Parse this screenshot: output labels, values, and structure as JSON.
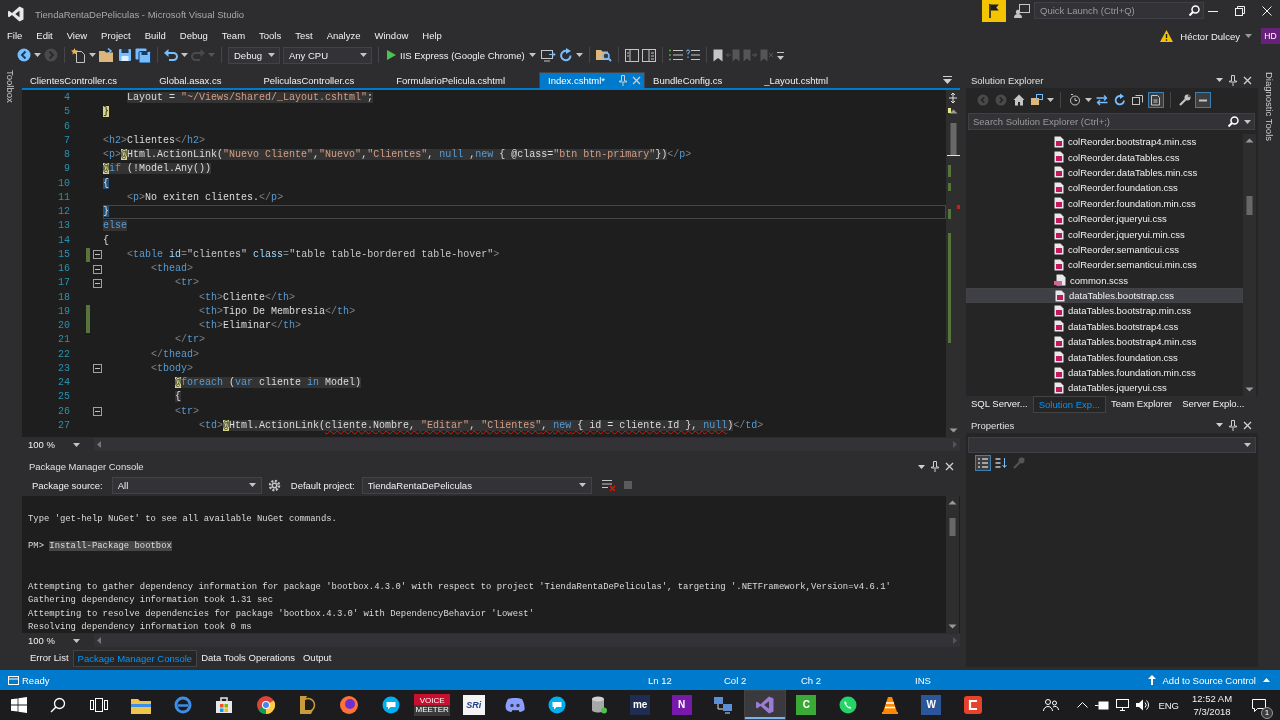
{
  "title_bar": {
    "title": "TiendaRentaDePeliculas - Microsoft Visual Studio",
    "quick_launch": {
      "placeholder": "Quick Launch (Ctrl+Q)"
    }
  },
  "menu": [
    "File",
    "Edit",
    "View",
    "Project",
    "Build",
    "Debug",
    "Team",
    "Tools",
    "Test",
    "Analyze",
    "Window",
    "Help"
  ],
  "account": {
    "name": "Héctor Dulcey",
    "initials": "HD"
  },
  "toolbar": [
    {
      "kind": "back",
      "disabled": false
    },
    {
      "kind": "forward",
      "disabled": true
    },
    {
      "kind": "new",
      "disabled": false
    },
    {
      "kind": "open",
      "disabled": false
    },
    {
      "kind": "save",
      "disabled": false
    },
    {
      "kind": "save-all",
      "disabled": false
    },
    {
      "kind": "undo",
      "disabled": false
    },
    {
      "kind": "redo",
      "disabled": true
    },
    {
      "kind": "dropdown",
      "value": "Debug",
      "disabled": false
    },
    {
      "kind": "dropdown",
      "value": "Any CPU",
      "disabled": false
    },
    {
      "kind": "run",
      "value": "IIS Express (Google Chrome)",
      "disabled": false
    },
    {
      "kind": "browser",
      "disabled": false
    },
    {
      "kind": "refresh",
      "disabled": false
    },
    {
      "kind": "find",
      "disabled": false
    },
    {
      "kind": "layout",
      "disabled": false
    },
    {
      "kind": "layout-split",
      "disabled": false
    },
    {
      "kind": "comment",
      "disabled": false
    },
    {
      "kind": "uncomment",
      "disabled": false
    },
    {
      "kind": "bookmark",
      "disabled": false
    },
    {
      "kind": "bookmark-prev",
      "disabled": true
    },
    {
      "kind": "bookmark-next",
      "disabled": true
    },
    {
      "kind": "bookmark-clear",
      "disabled": true
    },
    {
      "kind": "overflow",
      "disabled": false
    }
  ],
  "document_tabs": [
    {
      "label": "ClientesController.cs",
      "selected": false
    },
    {
      "label": "Global.asax.cs",
      "selected": false
    },
    {
      "label": "PeliculasController.cs",
      "selected": false
    },
    {
      "label": "FormularioPelicula.cshtml",
      "selected": false
    },
    {
      "label": "Index.cshtml*",
      "selected": true
    },
    {
      "label": "BundleConfig.cs",
      "selected": false
    },
    {
      "label": "_Layout.cshtml",
      "selected": false
    }
  ],
  "editor": {
    "lines": [
      {
        "number": "4",
        "changed": false,
        "fold": false,
        "current": false,
        "tokens": [
          {
            "kind": "cs",
            "text": "    Layout = "
          },
          {
            "kind": "cs-str",
            "text": "\"~/Views/Shared/_Layout.cshtml\""
          },
          {
            "kind": "cs",
            "text": ";"
          }
        ]
      },
      {
        "number": "5",
        "changed": false,
        "fold": false,
        "current": false,
        "tokens": [
          {
            "kind": "at",
            "text": "}"
          }
        ]
      },
      {
        "number": "6",
        "changed": false,
        "fold": false,
        "current": false
      },
      {
        "number": "7",
        "changed": false,
        "fold": false,
        "current": false,
        "tokens": [
          {
            "kind": "delim",
            "text": "<"
          },
          {
            "kind": "tag",
            "text": "h2"
          },
          {
            "kind": "delim",
            "text": ">"
          },
          {
            "kind": "text",
            "text": "Clientes"
          },
          {
            "kind": "delim",
            "text": "</"
          },
          {
            "kind": "tag",
            "text": "h2"
          },
          {
            "kind": "delim",
            "text": ">"
          }
        ]
      },
      {
        "number": "8",
        "changed": false,
        "fold": false,
        "current": false,
        "tokens": [
          {
            "kind": "delim",
            "text": "<"
          },
          {
            "kind": "tag",
            "text": "p"
          },
          {
            "kind": "delim",
            "text": ">"
          },
          {
            "kind": "at",
            "text": "@"
          },
          {
            "kind": "cs",
            "text": "Html.ActionLink("
          },
          {
            "kind": "cs-str",
            "text": "\"Nuevo Cliente\""
          },
          {
            "kind": "cs",
            "text": ","
          },
          {
            "kind": "cs-str",
            "text": "\"Nuevo\""
          },
          {
            "kind": "cs",
            "text": ","
          },
          {
            "kind": "cs-str",
            "text": "\"Clientes\""
          },
          {
            "kind": "cs",
            "text": ", "
          },
          {
            "kind": "cs-kw",
            "text": "null"
          },
          {
            "kind": "cs",
            "text": " ,"
          },
          {
            "kind": "cs-kw",
            "text": "new"
          },
          {
            "kind": "cs",
            "text": " { @class="
          },
          {
            "kind": "cs-str",
            "text": "\"btn btn-primary\""
          },
          {
            "kind": "cs",
            "text": "})"
          },
          {
            "kind": "delim",
            "text": "</"
          },
          {
            "kind": "tag",
            "text": "p"
          },
          {
            "kind": "delim",
            "text": ">"
          }
        ]
      },
      {
        "number": "9",
        "changed": false,
        "fold": false,
        "current": false,
        "tokens": [
          {
            "kind": "at",
            "text": "@"
          },
          {
            "kind": "cs-kw",
            "text": "if"
          },
          {
            "kind": "cs",
            "text": " (!Model.Any())"
          }
        ]
      },
      {
        "number": "10",
        "changed": false,
        "fold": false,
        "current": false,
        "tokens": [
          {
            "kind": "brace",
            "text": "{"
          }
        ]
      },
      {
        "number": "11",
        "changed": false,
        "fold": false,
        "current": false,
        "tokens": [
          {
            "kind": "delim",
            "text": "    <"
          },
          {
            "kind": "tag",
            "text": "p"
          },
          {
            "kind": "delim",
            "text": ">"
          },
          {
            "kind": "text",
            "text": "No exiten clientes."
          },
          {
            "kind": "delim",
            "text": "</"
          },
          {
            "kind": "tag",
            "text": "p"
          },
          {
            "kind": "delim",
            "text": ">"
          }
        ]
      },
      {
        "number": "12",
        "changed": false,
        "fold": false,
        "current": true,
        "tokens": [
          {
            "kind": "brace",
            "text": "}"
          }
        ]
      },
      {
        "number": "13",
        "changed": false,
        "fold": false,
        "current": false,
        "tokens": [
          {
            "kind": "cs-kw",
            "text": "else"
          }
        ]
      },
      {
        "number": "14",
        "changed": false,
        "fold": false,
        "current": false,
        "tokens": [
          {
            "kind": "text",
            "text": "{"
          }
        ]
      },
      {
        "number": "15",
        "changed": true,
        "fold": true,
        "current": false,
        "tokens": [
          {
            "kind": "delim",
            "text": "    <"
          },
          {
            "kind": "tag",
            "text": "table"
          },
          {
            "kind": "attr",
            "text": " id"
          },
          {
            "kind": "delim",
            "text": "="
          },
          {
            "kind": "val",
            "text": "\"clientes\""
          },
          {
            "kind": "attr",
            "text": " class"
          },
          {
            "kind": "delim",
            "text": "="
          },
          {
            "kind": "val",
            "text": "\"table table-bordered table-hover\""
          },
          {
            "kind": "delim",
            "text": ">"
          }
        ]
      },
      {
        "number": "16",
        "changed": false,
        "fold": true,
        "current": false,
        "tokens": [
          {
            "kind": "delim",
            "text": "        <"
          },
          {
            "kind": "tag",
            "text": "thead"
          },
          {
            "kind": "delim",
            "text": ">"
          }
        ]
      },
      {
        "number": "17",
        "changed": false,
        "fold": true,
        "current": false,
        "tokens": [
          {
            "kind": "delim",
            "text": "            <"
          },
          {
            "kind": "tag",
            "text": "tr"
          },
          {
            "kind": "delim",
            "text": ">"
          }
        ]
      },
      {
        "number": "18",
        "changed": false,
        "fold": false,
        "current": false,
        "tokens": [
          {
            "kind": "delim",
            "text": "                <"
          },
          {
            "kind": "tag",
            "text": "th"
          },
          {
            "kind": "delim",
            "text": ">"
          },
          {
            "kind": "text",
            "text": "Cliente"
          },
          {
            "kind": "delim",
            "text": "</"
          },
          {
            "kind": "tag",
            "text": "th"
          },
          {
            "kind": "delim",
            "text": ">"
          }
        ]
      },
      {
        "number": "19",
        "changed": true,
        "fold": false,
        "current": false,
        "tokens": [
          {
            "kind": "delim",
            "text": "                <"
          },
          {
            "kind": "tag",
            "text": "th"
          },
          {
            "kind": "delim",
            "text": ">"
          },
          {
            "kind": "text",
            "text": "Tipo De Membresia"
          },
          {
            "kind": "delim",
            "text": "</"
          },
          {
            "kind": "tag",
            "text": "th"
          },
          {
            "kind": "delim",
            "text": ">"
          }
        ]
      },
      {
        "number": "20",
        "changed": true,
        "fold": false,
        "current": false,
        "tokens": [
          {
            "kind": "delim",
            "text": "                <"
          },
          {
            "kind": "tag",
            "text": "th"
          },
          {
            "kind": "delim",
            "text": ">"
          },
          {
            "kind": "text",
            "text": "Eliminar"
          },
          {
            "kind": "delim",
            "text": "</"
          },
          {
            "kind": "tag",
            "text": "th"
          },
          {
            "kind": "delim",
            "text": ">"
          }
        ]
      },
      {
        "number": "21",
        "changed": false,
        "fold": false,
        "current": false,
        "tokens": [
          {
            "kind": "delim",
            "text": "            </"
          },
          {
            "kind": "tag",
            "text": "tr"
          },
          {
            "kind": "delim",
            "text": ">"
          }
        ]
      },
      {
        "number": "22",
        "changed": false,
        "fold": false,
        "current": false,
        "tokens": [
          {
            "kind": "delim",
            "text": "        </"
          },
          {
            "kind": "tag",
            "text": "thead"
          },
          {
            "kind": "delim",
            "text": ">"
          }
        ]
      },
      {
        "number": "23",
        "changed": false,
        "fold": true,
        "current": false,
        "tokens": [
          {
            "kind": "delim",
            "text": "        <"
          },
          {
            "kind": "tag",
            "text": "tbody"
          },
          {
            "kind": "delim",
            "text": ">"
          }
        ]
      },
      {
        "number": "24",
        "changed": false,
        "fold": false,
        "current": false,
        "tokens": [
          {
            "kind": "at",
            "text": "            @"
          },
          {
            "kind": "cs-kw",
            "text": "foreach"
          },
          {
            "kind": "cs",
            "text": " ("
          },
          {
            "kind": "cs-kw",
            "text": "var"
          },
          {
            "kind": "cs",
            "text": " cliente "
          },
          {
            "kind": "cs-kw",
            "text": "in"
          },
          {
            "kind": "cs",
            "text": " Model)"
          }
        ]
      },
      {
        "number": "25",
        "changed": false,
        "fold": false,
        "current": false,
        "tokens": [
          {
            "kind": "cs",
            "text": "            {"
          }
        ]
      },
      {
        "number": "26",
        "changed": false,
        "fold": true,
        "current": false,
        "tokens": [
          {
            "kind": "delim",
            "text": "            <"
          },
          {
            "kind": "tag",
            "text": "tr"
          },
          {
            "kind": "delim",
            "text": ">"
          }
        ]
      },
      {
        "number": "27",
        "changed": false,
        "fold": false,
        "current": false,
        "tokens": [
          {
            "kind": "delim",
            "text": "                <"
          },
          {
            "kind": "tag",
            "text": "td"
          },
          {
            "kind": "delim",
            "text": ">"
          },
          {
            "kind": "at",
            "text": "@"
          },
          {
            "kind": "cs",
            "text": "Html.ActionLink("
          },
          {
            "kind": "cs-err",
            "text": "cliente.Nombre, "
          },
          {
            "kind": "str-err",
            "text": "\"Editar\""
          },
          {
            "kind": "cs-err",
            "text": ", "
          },
          {
            "kind": "str-err",
            "text": "\"Clientes\""
          },
          {
            "kind": "cs-err",
            "text": ", "
          },
          {
            "kind": "kw-err",
            "text": "new"
          },
          {
            "kind": "cs-err",
            "text": " { id = cliente.Id }, "
          },
          {
            "kind": "kw-err",
            "text": "null"
          },
          {
            "kind": "cs",
            "text": ")"
          },
          {
            "kind": "delim",
            "text": "</"
          },
          {
            "kind": "tag",
            "text": "td"
          },
          {
            "kind": "delim",
            "text": ">"
          }
        ]
      }
    ],
    "zoom": "100 %"
  },
  "package_manager_console": {
    "title": "Package Manager Console",
    "source_label": "Package source:",
    "source": "All",
    "project_label": "Default project:",
    "project": "TiendaRentaDePeliculas",
    "lines": [
      {
        "kind": "output",
        "text": "Type 'get-help NuGet' to see all available NuGet commands."
      },
      {
        "kind": "blank"
      },
      {
        "kind": "command",
        "prompt": "PM>",
        "text": "Install-Package bootbox"
      },
      {
        "kind": "blank"
      },
      {
        "kind": "blank"
      },
      {
        "kind": "output",
        "text": "Attempting to gather dependency information for package 'bootbox.4.3.0' with respect to project 'TiendaRentaDePeliculas', targeting '.NETFramework,Version=v4.6.1'"
      },
      {
        "kind": "output",
        "text": "Gathering dependency information took 1.31 sec"
      },
      {
        "kind": "output",
        "text": "Attempting to resolve dependencies for package 'bootbox.4.3.0' with DependencyBehavior 'Lowest'"
      },
      {
        "kind": "output",
        "text": "Resolving dependency information took 0 ms"
      }
    ],
    "zoom": "100 %"
  },
  "bottom_tabs": [
    {
      "label": "Error List",
      "selected": false
    },
    {
      "label": "Package Manager Console",
      "selected": true
    },
    {
      "label": "Data Tools Operations",
      "selected": false
    },
    {
      "label": "Output",
      "selected": false
    }
  ],
  "solution_explorer": {
    "title": "Solution Explorer",
    "toolbar": [
      {
        "kind": "back",
        "disabled": true,
        "on": false
      },
      {
        "kind": "forward",
        "disabled": true,
        "on": false
      },
      {
        "kind": "home",
        "disabled": false,
        "on": false
      },
      {
        "kind": "switch-views",
        "disabled": false,
        "on": false
      },
      {
        "kind": "pending-changes",
        "disabled": false,
        "on": false
      },
      {
        "kind": "sync",
        "disabled": false,
        "on": false
      },
      {
        "kind": "refresh",
        "disabled": false,
        "on": false
      },
      {
        "kind": "collapse-all",
        "disabled": false,
        "on": false
      },
      {
        "kind": "show-all-files",
        "disabled": false,
        "on": true
      },
      {
        "kind": "properties",
        "disabled": false,
        "on": false
      },
      {
        "kind": "preview",
        "disabled": false,
        "on": true
      }
    ],
    "search": {
      "placeholder": "Search Solution Explorer (Ctrl+;)"
    },
    "items": [
      {
        "label": "colReorder.bootstrap4.min.css",
        "kind": "css",
        "selected": false
      },
      {
        "label": "colReorder.dataTables.css",
        "kind": "css",
        "selected": false
      },
      {
        "label": "colReorder.dataTables.min.css",
        "kind": "css",
        "selected": false
      },
      {
        "label": "colReorder.foundation.css",
        "kind": "css",
        "selected": false
      },
      {
        "label": "colReorder.foundation.min.css",
        "kind": "css",
        "selected": false
      },
      {
        "label": "colReorder.jqueryui.css",
        "kind": "css",
        "selected": false
      },
      {
        "label": "colReorder.jqueryui.min.css",
        "kind": "css",
        "selected": false
      },
      {
        "label": "colReorder.semanticui.css",
        "kind": "css",
        "selected": false
      },
      {
        "label": "colReorder.semanticui.min.css",
        "kind": "css",
        "selected": false
      },
      {
        "label": "common.scss",
        "kind": "scss",
        "selected": false
      },
      {
        "label": "dataTables.bootstrap.css",
        "kind": "css",
        "selected": true
      },
      {
        "label": "dataTables.bootstrap.min.css",
        "kind": "css",
        "selected": false
      },
      {
        "label": "dataTables.bootstrap4.css",
        "kind": "css",
        "selected": false
      },
      {
        "label": "dataTables.bootstrap4.min.css",
        "kind": "css",
        "selected": false
      },
      {
        "label": "dataTables.foundation.css",
        "kind": "css",
        "selected": false
      },
      {
        "label": "dataTables.foundation.min.css",
        "kind": "css",
        "selected": false
      },
      {
        "label": "dataTables.jqueryui.css",
        "kind": "css",
        "selected": false
      }
    ],
    "tabs": [
      {
        "label": "SQL Server...",
        "selected": false
      },
      {
        "label": "Solution Exp...",
        "selected": true
      },
      {
        "label": "Team Explorer",
        "selected": false
      },
      {
        "label": "Server Explo...",
        "selected": false
      }
    ]
  },
  "properties": {
    "title": "Properties",
    "toolbar": [
      {
        "kind": "categorized",
        "disabled": false,
        "on": true
      },
      {
        "kind": "alphabetical",
        "disabled": false,
        "on": false
      },
      {
        "kind": "property-pages",
        "disabled": true,
        "on": false
      }
    ]
  },
  "side_tabs": {
    "left": "Toolbox",
    "right": "Diagnostic Tools"
  },
  "status_bar": {
    "message": "Ready",
    "line": "Ln 12",
    "column": "Col 2",
    "character": "Ch 2",
    "mode": "INS",
    "source_control": "Add to Source Control"
  },
  "taskbar": {
    "items": [
      {
        "kind": "start",
        "selected": false
      },
      {
        "kind": "search",
        "selected": false
      },
      {
        "kind": "task-view",
        "selected": false
      },
      {
        "kind": "files",
        "selected": false
      },
      {
        "kind": "edge",
        "selected": false
      },
      {
        "kind": "store",
        "selected": false
      },
      {
        "kind": "chrome",
        "selected": false
      },
      {
        "kind": "league",
        "selected": false
      },
      {
        "kind": "firefox",
        "selected": false
      },
      {
        "kind": "skype",
        "selected": false
      },
      {
        "kind": "voicemeeter",
        "glyph": "VOICE MEETER",
        "selected": false
      },
      {
        "kind": "sri",
        "glyph": "SRi",
        "selected": false
      },
      {
        "kind": "discord",
        "selected": false
      },
      {
        "kind": "skype",
        "selected": false
      },
      {
        "kind": "database",
        "selected": false
      },
      {
        "kind": "me",
        "glyph": "me",
        "selected": false
      },
      {
        "kind": "onenote",
        "glyph": "N",
        "selected": false
      },
      {
        "kind": "network",
        "selected": false
      },
      {
        "kind": "visual-studio",
        "selected": true
      },
      {
        "kind": "camtasia",
        "glyph": "C",
        "selected": false
      },
      {
        "kind": "whatsapp",
        "selected": false
      },
      {
        "kind": "vlc",
        "selected": false
      },
      {
        "kind": "word",
        "glyph": "W",
        "selected": false
      },
      {
        "kind": "red-app",
        "selected": false
      }
    ],
    "language": "ENG",
    "time": "12:52 AM",
    "date": "7/3/2018",
    "notification_count": "1"
  }
}
